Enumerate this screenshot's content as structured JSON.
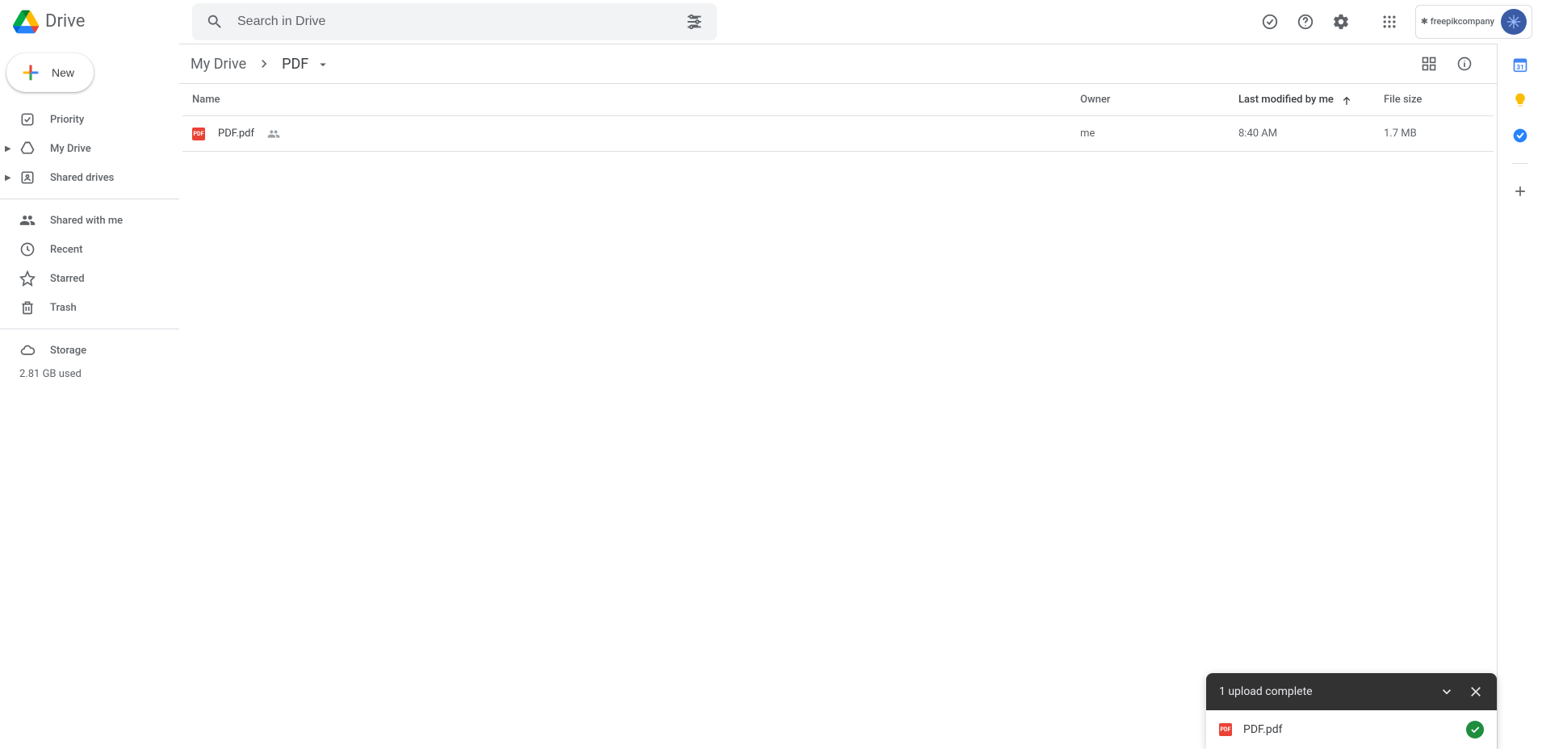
{
  "app": {
    "name": "Drive"
  },
  "search": {
    "placeholder": "Search in Drive"
  },
  "org": {
    "label": "✱ freepikcompany"
  },
  "new_button": "New",
  "sidebar": {
    "priority": "Priority",
    "my_drive": "My Drive",
    "shared_drives": "Shared drives",
    "shared_with_me": "Shared with me",
    "recent": "Recent",
    "starred": "Starred",
    "trash": "Trash",
    "storage": "Storage",
    "storage_used": "2.81 GB used"
  },
  "breadcrumb": {
    "root": "My Drive",
    "current": "PDF"
  },
  "columns": {
    "name": "Name",
    "owner": "Owner",
    "modified": "Last modified by me",
    "size": "File size"
  },
  "rows": [
    {
      "name": "PDF.pdf",
      "owner": "me",
      "modified": "8:40 AM",
      "size": "1.7 MB"
    }
  ],
  "toast": {
    "title": "1 upload complete",
    "file": "PDF.pdf"
  }
}
